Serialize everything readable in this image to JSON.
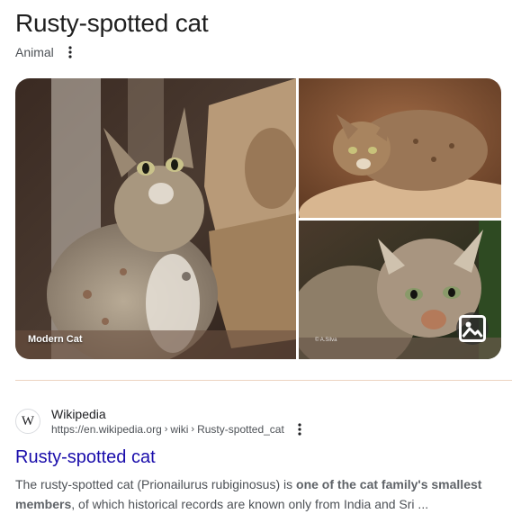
{
  "knowledge_panel": {
    "title": "Rusty-spotted cat",
    "subtitle": "Animal",
    "more_icon": "more-vert-icon"
  },
  "gallery": {
    "main_caption": "Modern Cat",
    "bottom_watermark": "© A.Silva",
    "view_images_icon": "image-icon"
  },
  "result": {
    "favicon_letter": "W",
    "site_name": "Wikipedia",
    "url_base": "https://en.wikipedia.org",
    "url_path_1": "wiki",
    "url_path_2": "Rusty-spotted_cat",
    "title": "Rusty-spotted cat",
    "snippet_start": "The rusty-spotted cat (Prionailurus rubiginosus) is ",
    "snippet_bold": "one of the cat family's smallest members",
    "snippet_end": ", of which historical records are known only from India and Sri ..."
  },
  "colors": {
    "link": "#1a0dab",
    "divider": "#ecd3c1",
    "text_secondary": "#4d5156"
  }
}
